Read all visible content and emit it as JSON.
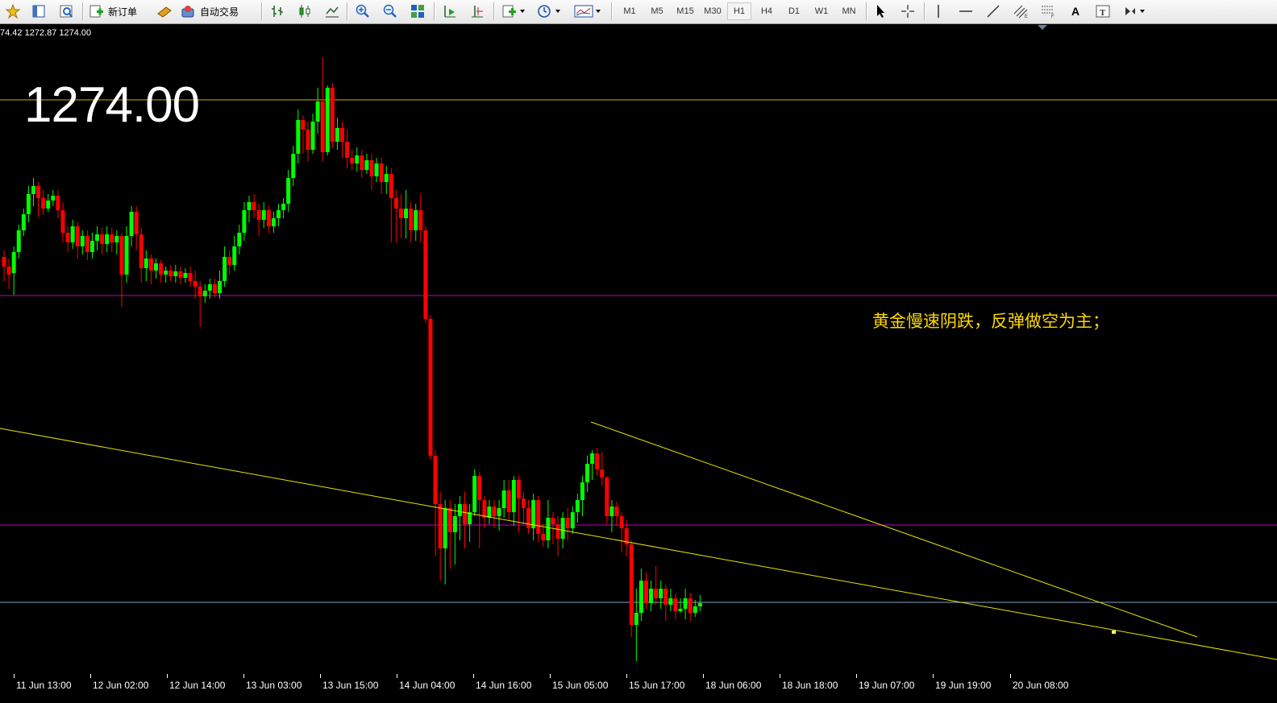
{
  "toolbar": {
    "new_order_label": "新订单",
    "auto_trading_label": "自动交易",
    "timeframes": [
      "M1",
      "M5",
      "M15",
      "M30",
      "H1",
      "H4",
      "D1",
      "W1",
      "MN"
    ],
    "active_timeframe": "H1",
    "text_tool_label": "A"
  },
  "chart": {
    "ohlc_readout": "74.42 1272.87 1274.00",
    "big_price": "1274.00",
    "annotation": "黄金慢速阴跌，反弹做空为主；",
    "colors": {
      "background": "#000000",
      "bull": "#00ff00",
      "bear": "#ff0000",
      "resistance_line": "#c8b400",
      "support_lines": "#c000c0",
      "current_price_line": "#80a8c8",
      "trendlines": "#e6e600",
      "annotation": "#ffd700"
    },
    "x_labels": [
      "11 Jun 13:00",
      "12 Jun 02:00",
      "12 Jun 14:00",
      "13 Jun 03:00",
      "13 Jun 15:00",
      "14 Jun 04:00",
      "14 Jun 16:00",
      "15 Jun 05:00",
      "15 Jun 17:00",
      "18 Jun 06:00",
      "18 Jun 18:00",
      "19 Jun 07:00",
      "19 Jun 19:00",
      "20 Jun 08:00"
    ]
  }
}
